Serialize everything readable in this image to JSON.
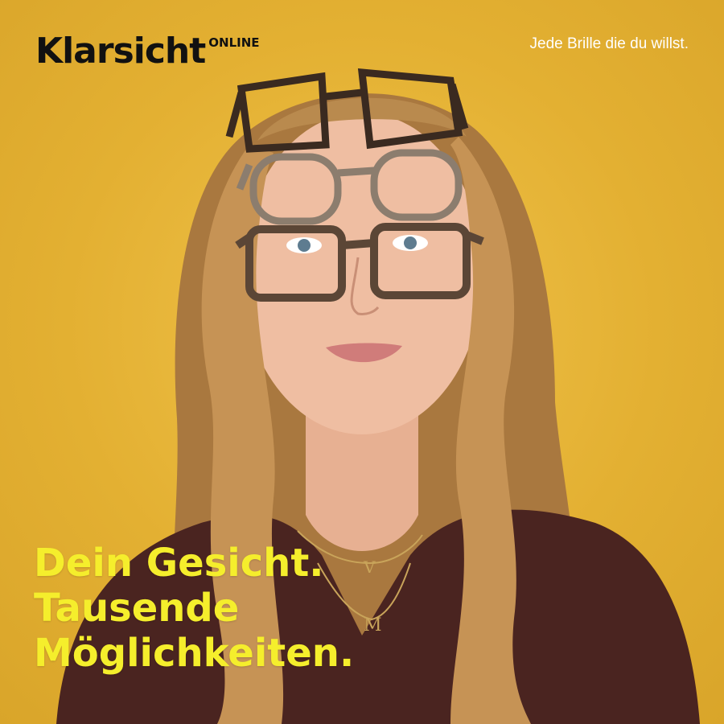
{
  "brand": {
    "name": "Klarsicht",
    "suffix": "ONLINE"
  },
  "tagline": "Jede Brille die du willst.",
  "headline": [
    "Dein Gesicht.",
    "Tausende",
    "Möglichkeiten."
  ],
  "necklace": {
    "pendant_top": "V",
    "pendant_bottom": "M"
  },
  "colors": {
    "background": "#e3b032",
    "headline": "#f5ee2c",
    "tagline": "#ffffff",
    "logo": "#111111",
    "shirt": "#4a2420",
    "hair": "#b98a4e"
  }
}
